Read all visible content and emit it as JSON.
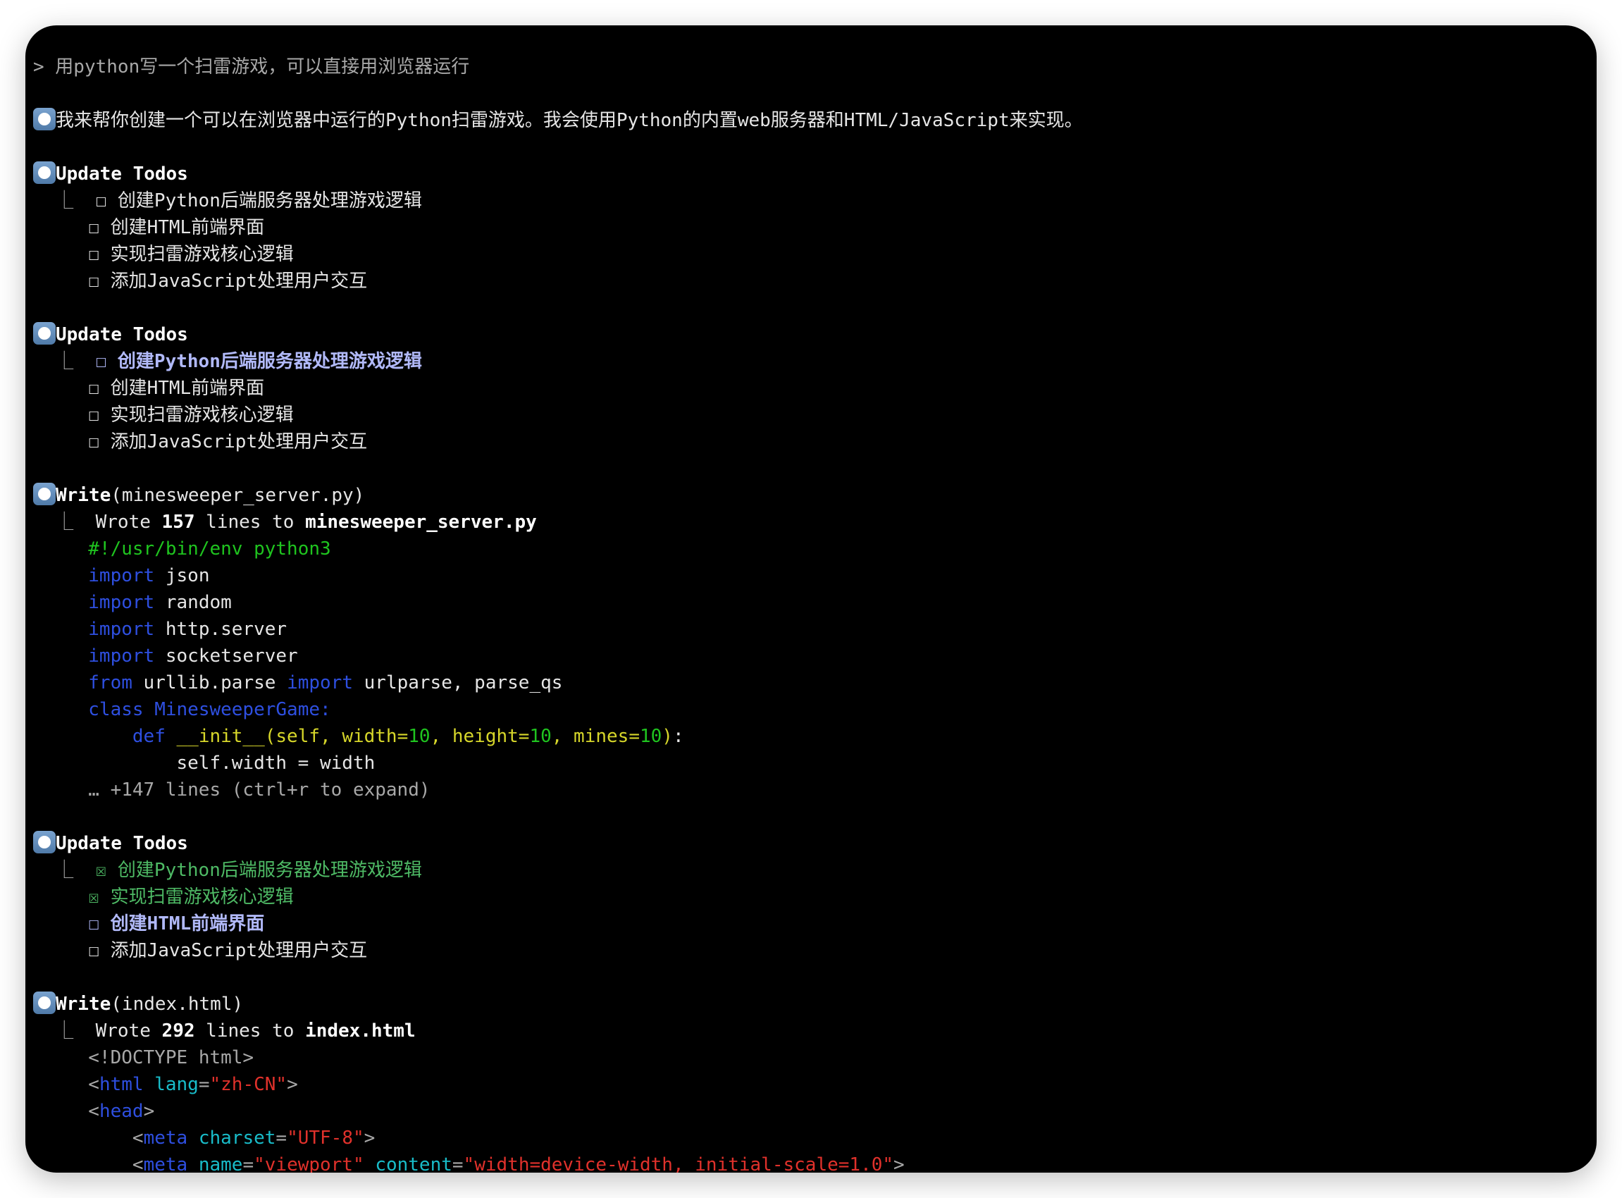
{
  "colors": {
    "background": "#000000",
    "bullet": "#5a86b4",
    "in_progress": "#b1b9f9",
    "completed": "#4eba65",
    "keyword": "#2e4fe0",
    "comment": "#1fc41f",
    "string": "#e0312b"
  },
  "lines": [
    {
      "kind": "prompt",
      "segs": [
        {
          "t": "> 用python写一个扫雷游戏，可以直接用浏览器运行",
          "c": "dim"
        }
      ]
    },
    {
      "kind": "blank",
      "segs": []
    },
    {
      "kind": "bullet",
      "segs": [
        {
          "t": "我来帮你创建一个可以在浏览器中运行的Python扫雷游戏。我会使用Python的内置web服务器和HTML/JavaScript来实现。",
          "c": "n"
        }
      ]
    },
    {
      "kind": "blank",
      "segs": []
    },
    {
      "kind": "bullet",
      "segs": [
        {
          "t": "Update Todos",
          "c": "b"
        }
      ]
    },
    {
      "kind": "text",
      "segs": [
        {
          "t": "  ⎿  ",
          "c": "dim"
        },
        {
          "t": "☐ 创建Python后端服务器处理游戏逻辑",
          "c": "n"
        }
      ]
    },
    {
      "kind": "text",
      "segs": [
        {
          "t": "     ☐ 创建HTML前端界面",
          "c": "n"
        }
      ]
    },
    {
      "kind": "text",
      "segs": [
        {
          "t": "     ☐ 实现扫雷游戏核心逻辑",
          "c": "n"
        }
      ]
    },
    {
      "kind": "text",
      "segs": [
        {
          "t": "     ☐ 添加JavaScript处理用户交互",
          "c": "n"
        }
      ]
    },
    {
      "kind": "blank",
      "segs": []
    },
    {
      "kind": "bullet",
      "segs": [
        {
          "t": "Update Todos",
          "c": "b"
        }
      ]
    },
    {
      "kind": "text",
      "segs": [
        {
          "t": "  ⎿  ",
          "c": "dim"
        },
        {
          "t": "☐ 创建Python后端服务器处理游戏逻辑",
          "c": "lav"
        }
      ]
    },
    {
      "kind": "text",
      "segs": [
        {
          "t": "     ☐ 创建HTML前端界面",
          "c": "n"
        }
      ]
    },
    {
      "kind": "text",
      "segs": [
        {
          "t": "     ☐ 实现扫雷游戏核心逻辑",
          "c": "n"
        }
      ]
    },
    {
      "kind": "text",
      "segs": [
        {
          "t": "     ☐ 添加JavaScript处理用户交互",
          "c": "n"
        }
      ]
    },
    {
      "kind": "blank",
      "segs": []
    },
    {
      "kind": "bullet",
      "segs": [
        {
          "t": "Write",
          "c": "b"
        },
        {
          "t": "(minesweeper_server.py)",
          "c": "n"
        }
      ]
    },
    {
      "kind": "text",
      "segs": [
        {
          "t": "  ⎿  ",
          "c": "dim"
        },
        {
          "t": "Wrote ",
          "c": "n"
        },
        {
          "t": "157",
          "c": "b"
        },
        {
          "t": " lines to ",
          "c": "n"
        },
        {
          "t": "minesweeper_server.py",
          "c": "b"
        }
      ]
    },
    {
      "kind": "code",
      "segs": [
        {
          "t": "     ",
          "c": "n"
        },
        {
          "t": "#!/usr/bin/env python3",
          "c": "cm"
        }
      ]
    },
    {
      "kind": "code",
      "segs": [
        {
          "t": "     ",
          "c": "n"
        },
        {
          "t": "import",
          "c": "kw"
        },
        {
          "t": " json",
          "c": "n"
        }
      ]
    },
    {
      "kind": "code",
      "segs": [
        {
          "t": "     ",
          "c": "n"
        },
        {
          "t": "import",
          "c": "kw"
        },
        {
          "t": " random",
          "c": "n"
        }
      ]
    },
    {
      "kind": "code",
      "segs": [
        {
          "t": "     ",
          "c": "n"
        },
        {
          "t": "import",
          "c": "kw"
        },
        {
          "t": " http.server",
          "c": "n"
        }
      ]
    },
    {
      "kind": "code",
      "segs": [
        {
          "t": "     ",
          "c": "n"
        },
        {
          "t": "import",
          "c": "kw"
        },
        {
          "t": " socketserver",
          "c": "n"
        }
      ]
    },
    {
      "kind": "code",
      "segs": [
        {
          "t": "     ",
          "c": "n"
        },
        {
          "t": "from",
          "c": "kw"
        },
        {
          "t": " urllib.parse ",
          "c": "n"
        },
        {
          "t": "import",
          "c": "kw"
        },
        {
          "t": " urlparse, parse_qs",
          "c": "n"
        }
      ]
    },
    {
      "kind": "code",
      "segs": [
        {
          "t": "     ",
          "c": "n"
        },
        {
          "t": "class MinesweeperGame:",
          "c": "kw"
        }
      ]
    },
    {
      "kind": "code",
      "segs": [
        {
          "t": "         ",
          "c": "n"
        },
        {
          "t": "def",
          "c": "kw"
        },
        {
          "t": " __init__(self, width=",
          "c": "yl"
        },
        {
          "t": "10",
          "c": "num"
        },
        {
          "t": ", height=",
          "c": "yl"
        },
        {
          "t": "10",
          "c": "num"
        },
        {
          "t": ", mines=",
          "c": "yl"
        },
        {
          "t": "10",
          "c": "num"
        },
        {
          "t": ")",
          "c": "yl"
        },
        {
          "t": ":",
          "c": "n"
        }
      ]
    },
    {
      "kind": "code",
      "segs": [
        {
          "t": "             self.width = width",
          "c": "n"
        }
      ]
    },
    {
      "kind": "text",
      "segs": [
        {
          "t": "     … +147 lines (ctrl+r to expand)",
          "c": "dim"
        }
      ]
    },
    {
      "kind": "blank",
      "segs": []
    },
    {
      "kind": "bullet",
      "segs": [
        {
          "t": "Update Todos",
          "c": "b"
        }
      ]
    },
    {
      "kind": "text",
      "segs": [
        {
          "t": "  ⎿  ",
          "c": "dim"
        },
        {
          "t": "☒ 创建Python后端服务器处理游戏逻辑",
          "c": "grn"
        }
      ]
    },
    {
      "kind": "text",
      "segs": [
        {
          "t": "     ",
          "c": "n"
        },
        {
          "t": "☒ 实现扫雷游戏核心逻辑",
          "c": "grn"
        }
      ]
    },
    {
      "kind": "text",
      "segs": [
        {
          "t": "     ",
          "c": "n"
        },
        {
          "t": "☐ 创建HTML前端界面",
          "c": "lav"
        }
      ]
    },
    {
      "kind": "text",
      "segs": [
        {
          "t": "     ☐ 添加JavaScript处理用户交互",
          "c": "n"
        }
      ]
    },
    {
      "kind": "blank",
      "segs": []
    },
    {
      "kind": "bullet",
      "segs": [
        {
          "t": "Write",
          "c": "b"
        },
        {
          "t": "(index.html)",
          "c": "n"
        }
      ]
    },
    {
      "kind": "text",
      "segs": [
        {
          "t": "  ⎿  ",
          "c": "dim"
        },
        {
          "t": "Wrote ",
          "c": "n"
        },
        {
          "t": "292",
          "c": "b"
        },
        {
          "t": " lines to ",
          "c": "n"
        },
        {
          "t": "index.html",
          "c": "b"
        }
      ]
    },
    {
      "kind": "code",
      "segs": [
        {
          "t": "     ",
          "c": "n"
        },
        {
          "t": "<!DOCTYPE html>",
          "c": "dim"
        }
      ]
    },
    {
      "kind": "code",
      "segs": [
        {
          "t": "     ",
          "c": "n"
        },
        {
          "t": "<",
          "c": "punct"
        },
        {
          "t": "html",
          "c": "tag"
        },
        {
          "t": " ",
          "c": "n"
        },
        {
          "t": "lang",
          "c": "attr"
        },
        {
          "t": "=",
          "c": "punct"
        },
        {
          "t": "\"zh-CN\"",
          "c": "str"
        },
        {
          "t": ">",
          "c": "punct"
        }
      ]
    },
    {
      "kind": "code",
      "segs": [
        {
          "t": "     ",
          "c": "n"
        },
        {
          "t": "<",
          "c": "punct"
        },
        {
          "t": "head",
          "c": "tag"
        },
        {
          "t": ">",
          "c": "punct"
        }
      ]
    },
    {
      "kind": "code",
      "segs": [
        {
          "t": "         ",
          "c": "n"
        },
        {
          "t": "<",
          "c": "punct"
        },
        {
          "t": "meta",
          "c": "tag"
        },
        {
          "t": " ",
          "c": "n"
        },
        {
          "t": "charset",
          "c": "attr"
        },
        {
          "t": "=",
          "c": "punct"
        },
        {
          "t": "\"UTF-8\"",
          "c": "str"
        },
        {
          "t": ">",
          "c": "punct"
        }
      ]
    },
    {
      "kind": "code",
      "segs": [
        {
          "t": "         ",
          "c": "n"
        },
        {
          "t": "<",
          "c": "punct"
        },
        {
          "t": "meta",
          "c": "tag"
        },
        {
          "t": " ",
          "c": "n"
        },
        {
          "t": "name",
          "c": "attr"
        },
        {
          "t": "=",
          "c": "punct"
        },
        {
          "t": "\"viewport\"",
          "c": "str"
        },
        {
          "t": " ",
          "c": "n"
        },
        {
          "t": "content",
          "c": "attr"
        },
        {
          "t": "=",
          "c": "punct"
        },
        {
          "t": "\"width=device-width, initial-scale=1.0\"",
          "c": "str"
        },
        {
          "t": ">",
          "c": "punct"
        }
      ]
    }
  ]
}
